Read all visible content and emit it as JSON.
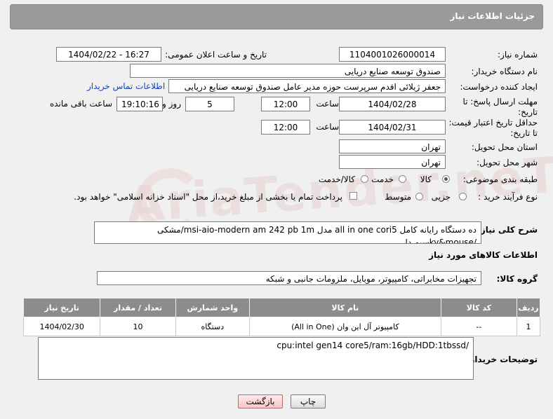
{
  "header": {
    "title": "جزئیات اطلاعات نیاز"
  },
  "fields": {
    "need_number_label": "شماره نیاز:",
    "need_number": "1104001026000014",
    "announce_label": "تاریخ و ساعت اعلان عمومی:",
    "announce_value": "1404/02/22 - 16:27",
    "buyer_org_label": "نام دستگاه خریدار:",
    "buyer_org": "صندوق توسعه صنایع دریایی",
    "requester_label": "ایجاد کننده درخواست:",
    "requester": "جعفر ژیلائی اقدم سرپرست حوزه مدیر عامل صندوق توسعه صنایع دریایی",
    "contact_link": "اطلاعات تماس خریدار",
    "deadline_label_1": "مهلت ارسال پاسخ: تا",
    "deadline_label_2": "تاریخ:",
    "deadline_date": "1404/02/28",
    "time_label": "ساعت",
    "deadline_time": "12:00",
    "days_value": "5",
    "days_label": "روز و",
    "remaining_time": "19:10:16",
    "remaining_label": "ساعت باقی مانده",
    "validity_label_1": "حداقل تاریخ اعتبار قیمت:",
    "validity_label_2": "تا تاریخ:",
    "validity_date": "1404/02/31",
    "validity_time": "12:00",
    "province_label": "استان محل تحویل:",
    "province": "تهران",
    "city_label": "شهر محل تحویل:",
    "city": "تهران",
    "category_label": "طبقه بندی موضوعی:",
    "category_options": [
      "کالا",
      "خدمت",
      "کالا/خدمت"
    ],
    "process_label": "نوع فرآیند خرید :",
    "process_options": [
      "جزیی",
      "متوسط"
    ],
    "payment_note": "پرداخت تمام یا بخشی از مبلغ خرید،از محل \"اسناد خزانه اسلامی\" خواهد بود."
  },
  "description": {
    "label": "شرح کلی نیاز:",
    "text": "ده دستگاه  رایانه  کامل all in one cori5 مدل msi-aio-modern am 242 pb 1m/مشکی /ky&mouseسیم دار"
  },
  "goods_section": {
    "title": "اطلاعات کالاهای مورد نیاز",
    "group_label": "گروه کالا:",
    "group_value": "تجهیزات مخابراتی، کامپیوتر، موبایل، ملزومات جانبی و شبکه"
  },
  "table": {
    "headers": [
      "ردیف",
      "کد کالا",
      "نام کالا",
      "واحد شمارش",
      "تعداد / مقدار",
      "تاریخ نیاز"
    ],
    "rows": [
      [
        "1",
        "--",
        "کامپیوتر آل این وان (All in One)",
        "دستگاه",
        "10",
        "1404/02/30"
      ]
    ]
  },
  "buyer_notes": {
    "label": "توضیحات خریدار:",
    "text": "cpu:intel gen14 core5/ram:16gb/HDD:1tbssd/"
  },
  "buttons": {
    "print": "چاپ",
    "back": "بازگشت"
  },
  "watermark": "AriaTender.neT"
}
